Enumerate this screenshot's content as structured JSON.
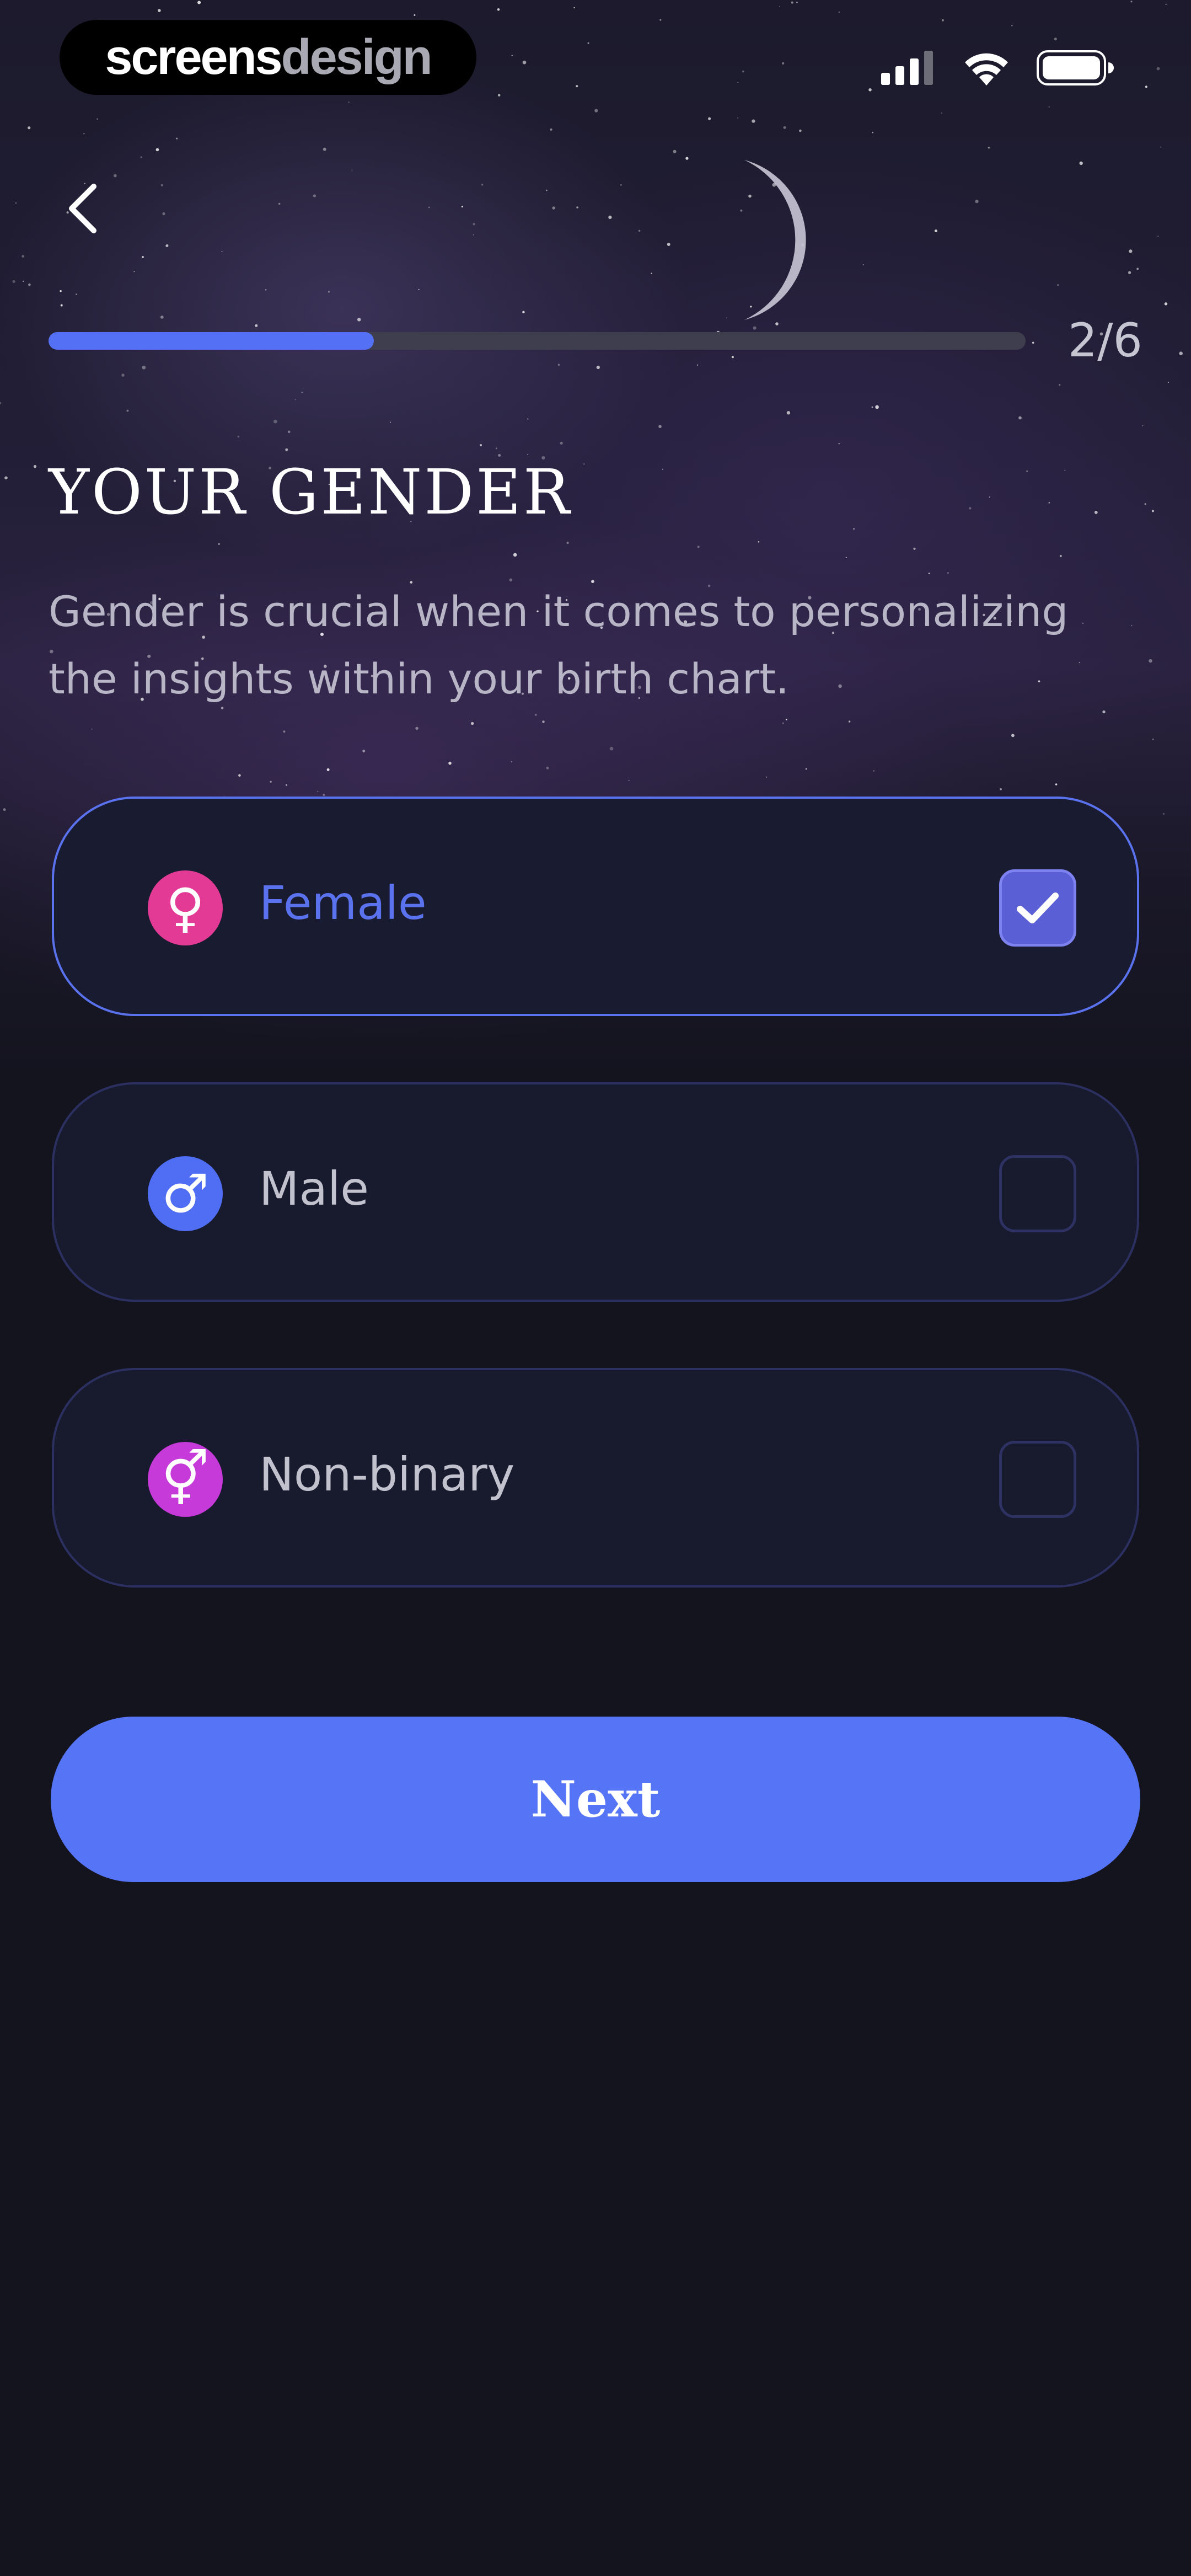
{
  "status_bar": {
    "brand_part1": "screens",
    "brand_part2": "design",
    "icons": [
      "cellular-signal-icon",
      "wifi-icon",
      "battery-icon"
    ]
  },
  "navigation": {
    "back_icon": "chevron-left-icon"
  },
  "progress": {
    "label": "2/6",
    "fraction": 0.333
  },
  "title": "YOUR GENDER",
  "subtitle": "Gender is crucial when it comes to personalizing the insights within your birth chart.",
  "options": [
    {
      "label": "Female",
      "icon": "female-symbol-icon",
      "icon_color": "#e23a95",
      "selected": true
    },
    {
      "label": "Male",
      "icon": "male-symbol-icon",
      "icon_color": "#4f6ef3",
      "selected": false
    },
    {
      "label": "Non-binary",
      "icon": "non-binary-symbol-icon",
      "icon_color": "#c53ad8",
      "selected": false
    }
  ],
  "next_button": {
    "label": "Next"
  },
  "colors": {
    "accent": "#5574f6",
    "background": "#14141f",
    "card_background": "#181a2e",
    "card_border": "#2c3060",
    "selected_border": "#5a72ee",
    "checkbox_checked": "#5a5fd6"
  }
}
